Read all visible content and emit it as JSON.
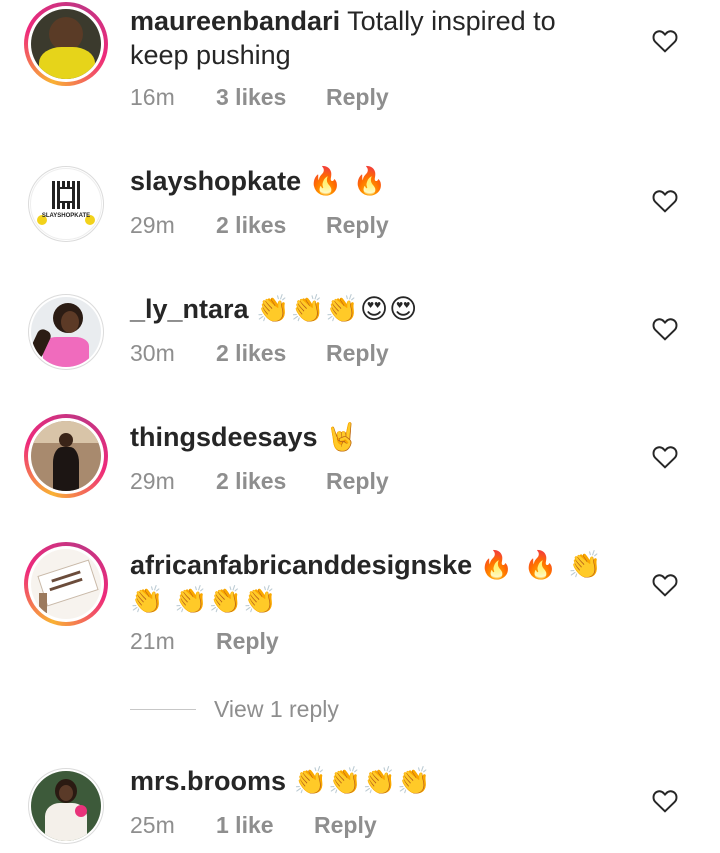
{
  "comments": [
    {
      "username": "maureenbandari",
      "text": "Totally inspired to keep pushing",
      "time": "16m",
      "likes": "3 likes",
      "reply": "Reply",
      "avatar": "photo woman in yellow top"
    },
    {
      "username": "slayshopkate",
      "text": "🔥 🔥",
      "time": "29m",
      "likes": "2 likes",
      "reply": "Reply",
      "avatar": "qr code logo",
      "avatar_caption": "SLAYSHOPKATE"
    },
    {
      "username": "_ly_ntara",
      "text": "👏👏👏😍😍",
      "time": "30m",
      "likes": "2 likes",
      "reply": "Reply",
      "avatar": "photo woman in pink top"
    },
    {
      "username": "thingsdeesays",
      "text": "🤘",
      "time": "29m",
      "likes": "2 likes",
      "reply": "Reply",
      "avatar": "photo woman in dark dress"
    },
    {
      "username": "africanfabricanddesignske",
      "text": "🔥 🔥 👏👏 👏👏👏",
      "time": "21m",
      "reply": "Reply",
      "avatar": "fabric brand logo",
      "view_replies": "View 1 reply"
    },
    {
      "username": "mrs.brooms",
      "text": "👏👏👏👏",
      "time": "25m",
      "likes": "1 like",
      "reply": "Reply",
      "avatar": "photo woman in floral dress"
    }
  ],
  "colors": {
    "text": "#262626",
    "meta": "#8e8e8e",
    "ring_start": "#f9b233",
    "ring_end": "#c13584"
  },
  "icons": [
    "heart-outline-icon"
  ]
}
